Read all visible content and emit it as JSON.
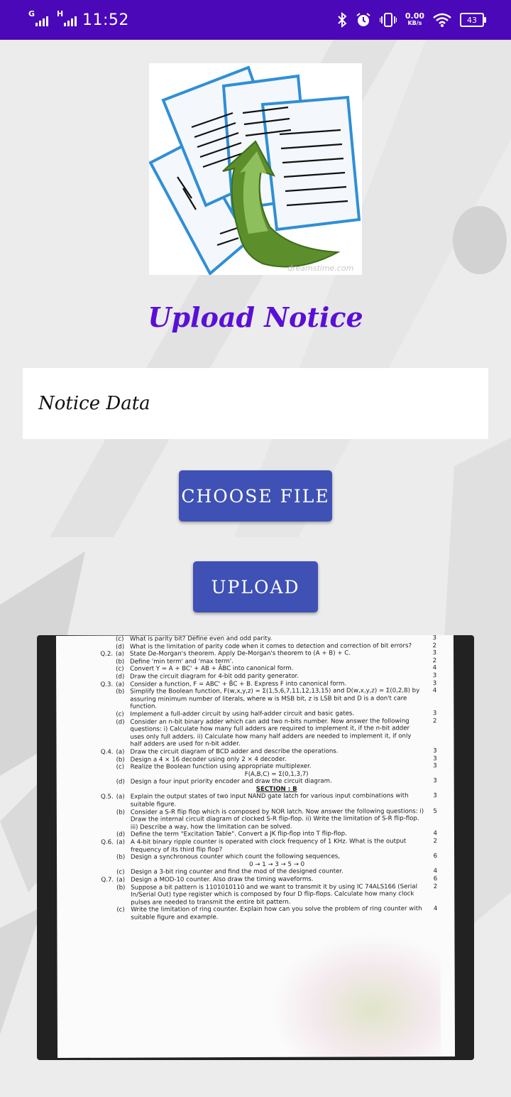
{
  "status_bar": {
    "network_1": "G",
    "network_2": "H",
    "time": "11:52",
    "speed_value": "0.00",
    "speed_unit": "KB/s",
    "battery": "43",
    "icons": [
      "bluetooth-icon",
      "alarm-icon",
      "vibrate-icon",
      "wifi-icon",
      "battery-icon"
    ]
  },
  "logo": {
    "icon": "document-upload-icon",
    "watermark": "dreamstime.com"
  },
  "page_title": "Upload Notice",
  "notice_input": {
    "placeholder": "Notice Data",
    "value": ""
  },
  "buttons": {
    "choose_file": "CHOOSE FILE",
    "upload": "UPLOAD"
  },
  "colors": {
    "status_bar": "#4a08b8",
    "title": "#5a0fd6",
    "button": "#3f51b5"
  },
  "preview": {
    "rows": [
      {
        "q": "",
        "s": "(c)",
        "t": "What is parity bit? Define even and odd parity.",
        "m": "3"
      },
      {
        "q": "",
        "s": "(d)",
        "t": "What is the limitation of parity code when it comes to detection and correction of bit errors?",
        "m": "2"
      },
      {
        "q": "Q.2.",
        "s": "(a)",
        "t": "State De-Morgan's theorem. Apply De-Morgan's theorem to (A + B) + C.",
        "m": "3"
      },
      {
        "q": "",
        "s": "(b)",
        "t": "Define 'min term' and 'max term'.",
        "m": "2"
      },
      {
        "q": "",
        "s": "(c)",
        "t": "Convert Y = A + BC' + AB + ĀBC into canonical form.",
        "m": "4"
      },
      {
        "q": "",
        "s": "(d)",
        "t": "Draw the circuit diagram for 4-bit odd parity generator.",
        "m": "3"
      },
      {
        "q": "Q.3.",
        "s": "(a)",
        "t": "Consider a function, F = ABC' + B̄C + B. Express F into canonical form.",
        "m": "3"
      },
      {
        "q": "",
        "s": "(b)",
        "t": "Simplify the Boolean function, F(w,x,y,z) = Σ(1,5,6,7,11,12,13,15) and D(w,x,y,z) = Σ(0,2,8) by assuring minimum number of literals, where w is MSB bit, z is LSB bit and D is a don't care function.",
        "m": "4"
      },
      {
        "q": "",
        "s": "(c)",
        "t": "Implement a full-adder circuit by using half-adder circuit and basic gates.",
        "m": "3"
      },
      {
        "q": "",
        "s": "(d)",
        "t": "Consider an n-bit binary adder which can add two n-bits number. Now answer the following questions: i) Calculate how many full adders are required to implement it, if the n-bit adder uses only full adders. ii) Calculate how many half adders are needed to implement it, if only half adders are used for n-bit adder.",
        "m": "2"
      },
      {
        "q": "Q.4.",
        "s": "(a)",
        "t": "Draw the circuit diagram of BCD adder and describe the operations.",
        "m": "3"
      },
      {
        "q": "",
        "s": "(b)",
        "t": "Design a 4 × 16 decoder using only 2 × 4 decoder.",
        "m": "3"
      },
      {
        "q": "",
        "s": "(c)",
        "t": "Realize the Boolean function using appropriate multiplexer.",
        "m": "3"
      },
      {
        "q": "",
        "s": "",
        "t": "F(A,B,C) = Σ(0,1,3,7)",
        "m": "",
        "center": true
      },
      {
        "q": "",
        "s": "(d)",
        "t": "Design a four input priority encoder and draw the circuit diagram.",
        "m": "3"
      },
      {
        "q": "",
        "s": "",
        "t": "SECTION : B",
        "m": "",
        "section": true
      },
      {
        "q": "Q.5.",
        "s": "(a)",
        "t": "Explain the output states of two input NAND gate latch for various input combinations with suitable figure.",
        "m": "3"
      },
      {
        "q": "",
        "s": "(b)",
        "t": "Consider a S-R flip flop which is composed by NOR latch. Now answer the following questions: i) Draw the internal circuit diagram of clocked S-R flip-flop. ii) Write the limitation of S-R flip-flop. iii) Describe a way, how the limitation can be solved.",
        "m": "5"
      },
      {
        "q": "",
        "s": "(d)",
        "t": "Define the term \"Excitation Table\". Convert a JK flip-flop into T flip-flop.",
        "m": "4"
      },
      {
        "q": "Q.6.",
        "s": "(a)",
        "t": "A 4-bit binary ripple counter is operated with clock frequency of 1 KHz. What is the output frequency of its third flip flop?",
        "m": "2"
      },
      {
        "q": "",
        "s": "(b)",
        "t": "Design a synchronous counter which count the following sequences,",
        "m": "6"
      },
      {
        "q": "",
        "s": "",
        "t": "0 → 1 → 3 → 5 → 0",
        "m": "",
        "center": true
      },
      {
        "q": "",
        "s": "(c)",
        "t": "Design a 3-bit ring counter and find the mod of the designed counter.",
        "m": "4"
      },
      {
        "q": "Q.7.",
        "s": "(a)",
        "t": "Design a MOD-10 counter. Also draw the timing waveforms.",
        "m": "6"
      },
      {
        "q": "",
        "s": "(b)",
        "t": "Suppose a bit pattern is 1101010110 and we want to transmit it by using IC 74ALS166 (Serial In/Serial Out) type register which is composed by four D flip-flops. Calculate how many clock pulses are needed to transmit the entire bit pattern.",
        "m": "2"
      },
      {
        "q": "",
        "s": "(c)",
        "t": "Write the limitation of ring counter. Explain how can you solve the problem of ring counter with suitable figure and example.",
        "m": "4"
      }
    ]
  }
}
